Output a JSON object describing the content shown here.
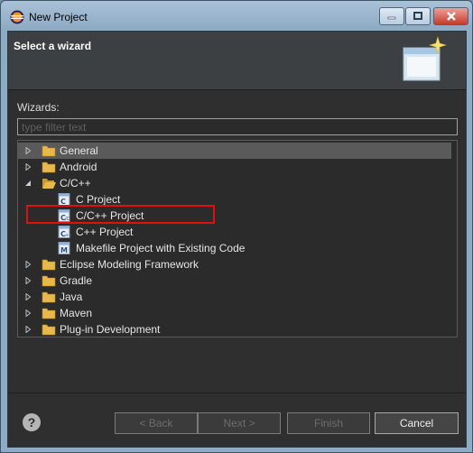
{
  "window": {
    "title": "New Project",
    "accent_close": "#c53a2d"
  },
  "header": {
    "title": "Select a wizard"
  },
  "wizards": {
    "label": "Wizards:",
    "filter_placeholder": "type filter text"
  },
  "tree": [
    {
      "label": "General",
      "icon": "folder-icon",
      "state": "collapsed",
      "selected": true
    },
    {
      "label": "Android",
      "icon": "folder-icon",
      "state": "collapsed"
    },
    {
      "label": "C/C++",
      "icon": "folder-open-icon",
      "state": "expanded"
    },
    {
      "label": "C Project",
      "icon": "c-project-icon"
    },
    {
      "label": "C/C++ Project",
      "icon": "c-cpp-project-icon",
      "highlighted": true
    },
    {
      "label": "C++ Project",
      "icon": "cpp-project-icon"
    },
    {
      "label": "Makefile Project with Existing Code",
      "icon": "makefile-project-icon"
    },
    {
      "label": "Eclipse Modeling Framework",
      "icon": "folder-icon",
      "state": "collapsed"
    },
    {
      "label": "Gradle",
      "icon": "folder-icon",
      "state": "collapsed"
    },
    {
      "label": "Java",
      "icon": "folder-icon",
      "state": "collapsed"
    },
    {
      "label": "Maven",
      "icon": "folder-icon",
      "state": "collapsed"
    },
    {
      "label": "Plug-in Development",
      "icon": "folder-icon",
      "state": "collapsed"
    }
  ],
  "buttons": {
    "help": "?",
    "back": "< Back",
    "next": "Next >",
    "finish": "Finish",
    "cancel": "Cancel"
  },
  "colors": {
    "highlight_border": "#e01010",
    "folder": "#e8b84a"
  }
}
